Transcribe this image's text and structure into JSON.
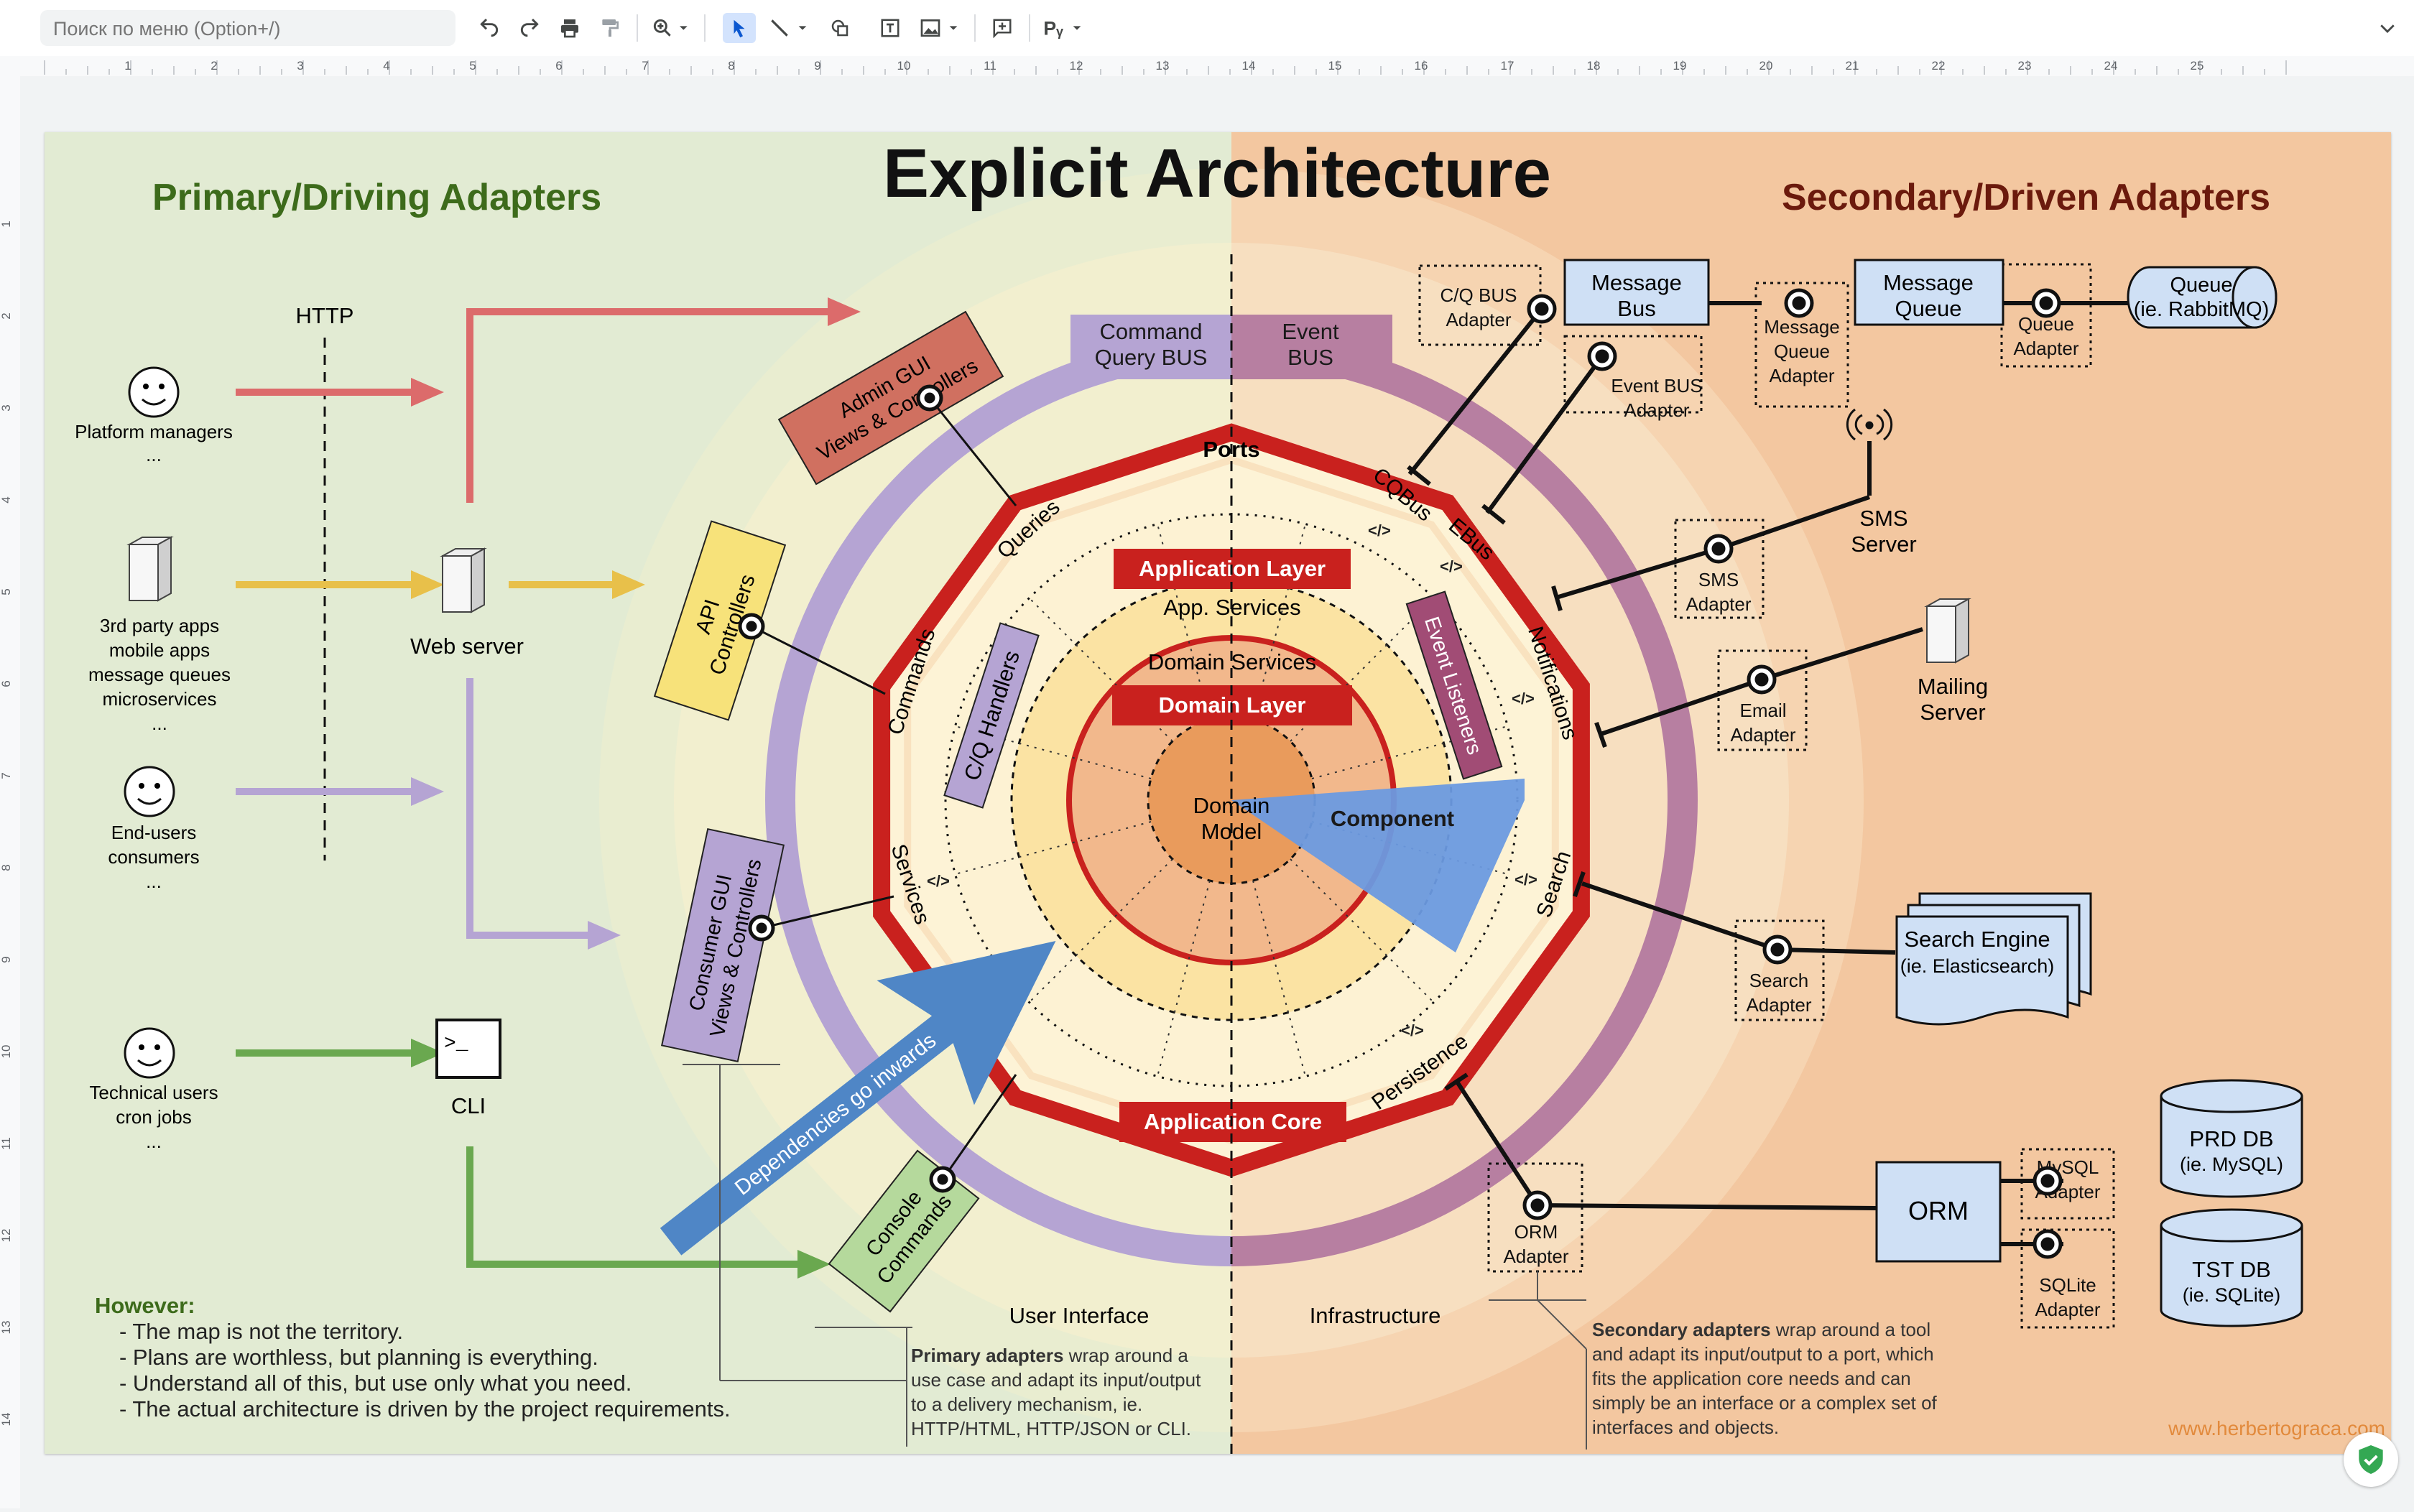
{
  "toolbar": {
    "search_placeholder": "Поиск по меню (Option+/)",
    "icons": [
      "undo-icon",
      "redo-icon",
      "print-icon",
      "paint-format-icon",
      "zoom-icon",
      "select-icon",
      "line-icon",
      "shape-icon",
      "text-box-icon",
      "image-icon",
      "comment-icon",
      "spellcheck-icon",
      "collapse-icon"
    ]
  },
  "rulers": {
    "h_ticks": [
      "1",
      "2",
      "3",
      "4",
      "5",
      "6",
      "7",
      "8",
      "9",
      "10",
      "11",
      "12",
      "13",
      "14",
      "15",
      "16",
      "17",
      "18",
      "19",
      "20",
      "21",
      "22",
      "23",
      "24",
      "25"
    ],
    "v_ticks": [
      "1",
      "2",
      "3",
      "4",
      "5",
      "6",
      "7",
      "8",
      "9",
      "10",
      "11",
      "12",
      "13",
      "14"
    ]
  },
  "diagram": {
    "title": "Explicit Architecture",
    "primary_title": "Primary/Driving Adapters",
    "secondary_title": "Secondary/Driven Adapters",
    "http": "HTTP",
    "actors": {
      "platform": [
        "Platform managers",
        "..."
      ],
      "third_party": [
        "3rd party apps",
        "mobile apps",
        "message queues",
        "microservices",
        "..."
      ],
      "end_users": [
        "End-users",
        "consumers",
        "..."
      ],
      "technical": [
        "Technical users",
        "cron jobs",
        "..."
      ]
    },
    "web_server": "Web server",
    "cli": "CLI",
    "cli_prompt": ">_",
    "admin_gui": [
      "Admin GUI",
      "Views & Controllers"
    ],
    "api_controllers": [
      "API",
      "Controllers"
    ],
    "consumer_gui": [
      "Consumer GUI",
      "Views & Controllers"
    ],
    "console_commands": [
      "Console",
      "Commands"
    ],
    "cq_handlers": "C/Q Handlers",
    "event_listeners": "Event Listeners",
    "command_query_bus": [
      "Command",
      "Query BUS"
    ],
    "event_bus": [
      "Event",
      "BUS"
    ],
    "ports": "Ports",
    "port_labels": {
      "queries": "Queries",
      "commands": "Commands",
      "services": "Services",
      "cqbus": "CQBus",
      "ebus": "EBus",
      "notifications": "Notifications",
      "search": "Search",
      "persistence": "Persistence"
    },
    "application_layer": "Application Layer",
    "app_services": "App. Services",
    "domain_services": "Domain Services",
    "domain_layer": "Domain Layer",
    "domain_model": [
      "Domain",
      "Model"
    ],
    "component": "Component",
    "application_core": "Application Core",
    "dependencies": "Dependencies go inwards",
    "cq_bus_adapter": [
      "C/Q BUS",
      "Adapter"
    ],
    "message_bus": [
      "Message",
      "Bus"
    ],
    "event_bus_adapter": [
      "Event BUS",
      "Adapter"
    ],
    "message_queue_adapter": [
      "Message",
      "Queue",
      "Adapter"
    ],
    "message_queue": [
      "Message",
      "Queue"
    ],
    "queue_adapter": [
      "Queue",
      "Adapter"
    ],
    "queue": [
      "Queue",
      "(ie. RabbitMQ)"
    ],
    "sms_server": [
      "SMS",
      "Server"
    ],
    "sms_adapter": [
      "SMS",
      "Adapter"
    ],
    "mailing_server": [
      "Mailing",
      "Server"
    ],
    "email_adapter": [
      "Email",
      "Adapter"
    ],
    "search_engine": [
      "Search Engine",
      "(ie. Elasticsearch)"
    ],
    "search_adapter": [
      "Search",
      "Adapter"
    ],
    "orm": "ORM",
    "orm_adapter": [
      "ORM",
      "Adapter"
    ],
    "mysql_adapter": [
      "MySQL",
      "Adapter"
    ],
    "sqlite_adapter": [
      "SQLite",
      "Adapter"
    ],
    "prd_db": [
      "PRD DB",
      "(ie. MySQL)"
    ],
    "tst_db": [
      "TST DB",
      "(ie. SQLite)"
    ],
    "user_interface": "User Interface",
    "infrastructure": "Infrastructure",
    "however_title": "However:",
    "however_items": [
      "- The map is not the territory.",
      "- Plans are worthless, but planning is everything.",
      "- Understand all of this, but use only what you need.",
      "- The actual architecture is driven by the project requirements."
    ],
    "primary_note_bold": "Primary adapters",
    "primary_note_lines": [
      " wrap around a",
      "use case and adapt its input/output",
      "to a delivery mechanism, ie.",
      "HTTP/HTML, HTTP/JSON or CLI."
    ],
    "secondary_note_bold": "Secondary adapters",
    "secondary_note_lines": [
      " wrap around a tool",
      "and adapt its input/output to a port, which",
      "fits the application core needs and can",
      "simply be an interface or a complex set of",
      "interfaces and objects."
    ],
    "website": "www.herbertograca.com"
  },
  "colors": {
    "left_bg": "#e2ebd3",
    "right_bg": "#f3c7a0",
    "title_green": "#3d6b1b",
    "title_darkred": "#6b1a0d",
    "core_red": "#c9211e",
    "bus_purple": "#b5a4d3",
    "bus_mauve": "#b77fa1",
    "arrow_blue": "#4f86c6"
  }
}
